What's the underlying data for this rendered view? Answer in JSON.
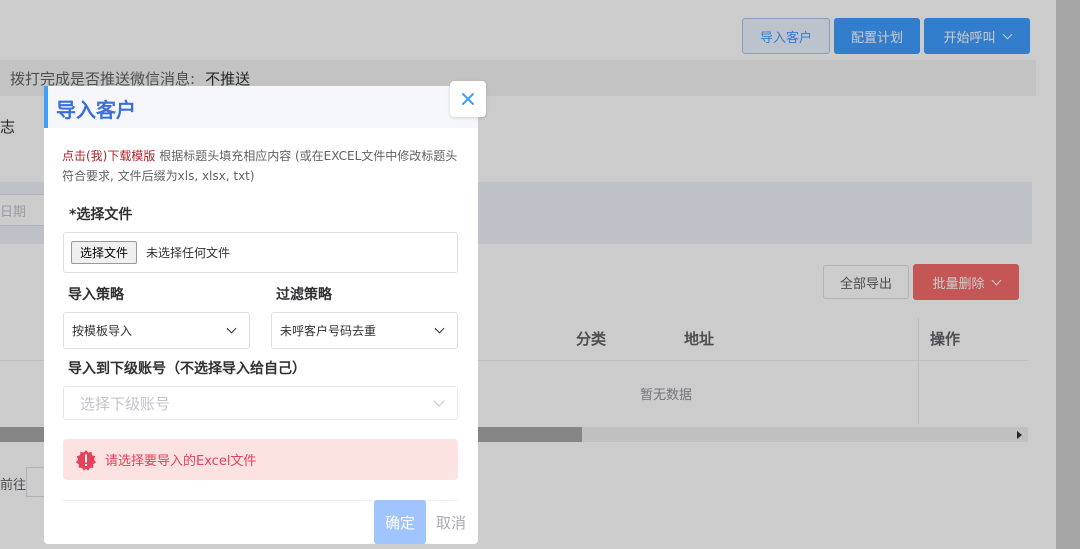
{
  "toolbar": {
    "import_label": "导入客户",
    "config_label": "配置计划",
    "call_label": "开始呼叫"
  },
  "info": {
    "label": "拨打完成是否推送微信消息:",
    "value": "不推送"
  },
  "tab_fragment": "志",
  "filter": {
    "date_placeholder": "日期"
  },
  "table_actions": {
    "export_label": "全部导出",
    "bulk_delete_label": "批量删除"
  },
  "table": {
    "columns": [
      "分类",
      "地址",
      "操作"
    ],
    "empty_text": "暂无数据"
  },
  "pager": {
    "goto_label": "前往"
  },
  "dialog": {
    "title": "导入客户",
    "hint_link": "点击(我)下载模版",
    "hint_text": " 根据标题头填充相应内容 (或在EXCEL文件中修改标题头符合要求, 文件后缀为xls, xlsx, txt)",
    "file_label": "*选择文件",
    "file_button": "选择文件",
    "file_none": "未选择任何文件",
    "import_strategy_label": "导入策略",
    "import_strategy_value": "按模板导入",
    "filter_strategy_label": "过滤策略",
    "filter_strategy_value": "未呼客户号码去重",
    "sub_account_label": "导入到下级账号（不选择导入给自己）",
    "sub_account_placeholder": "选择下级账号",
    "alert_text": "请选择要导入的Excel文件",
    "ok_label": "确定",
    "cancel_label": "取消"
  },
  "colors": {
    "primary": "#409eff",
    "danger": "#f56c6c",
    "alert_bg": "#fde2e2",
    "alert_text": "#e6405a",
    "hint_link": "#b0232a"
  }
}
